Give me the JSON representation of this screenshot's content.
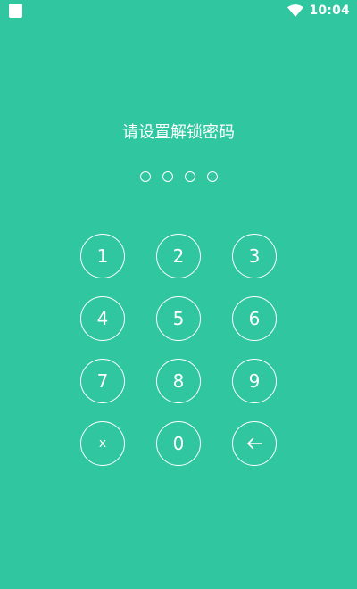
{
  "status_bar": {
    "time": "10:04",
    "icons": [
      "app-notification-icon",
      "wifi-icon"
    ]
  },
  "title": "请设置解锁密码",
  "pin": {
    "length": 4,
    "filled": 0
  },
  "keypad": {
    "keys": [
      "1",
      "2",
      "3",
      "4",
      "5",
      "6",
      "7",
      "8",
      "9",
      "x",
      "0"
    ],
    "backspace_icon": "arrow-left-icon"
  },
  "colors": {
    "background": "#2FC6A0",
    "foreground": "#FFFFFF"
  }
}
